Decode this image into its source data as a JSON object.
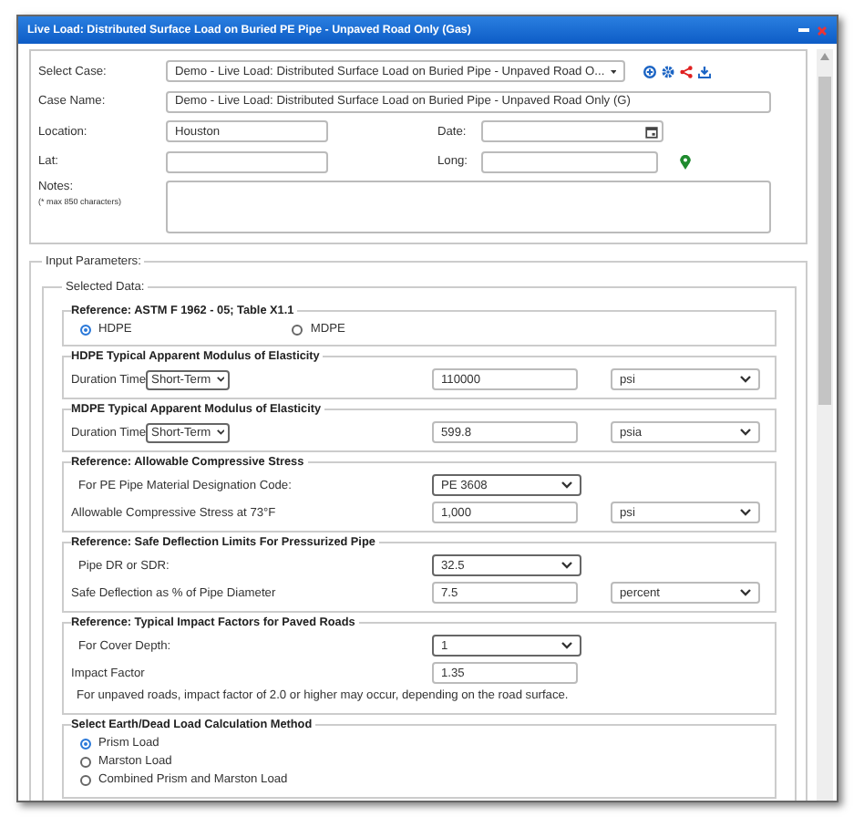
{
  "window": {
    "title": "Live Load: Distributed Surface Load on Buried PE Pipe - Unpaved Road Only (Gas)"
  },
  "case": {
    "select_case": {
      "label": "Select Case:",
      "value": "Demo - Live Load: Distributed Surface Load on Buried Pipe - Unpaved Road O..."
    },
    "case_name": {
      "label": "Case Name:",
      "value": "Demo - Live Load: Distributed Surface Load on Buried Pipe - Unpaved Road Only (G)"
    },
    "location": {
      "label": "Location:",
      "value": "Houston"
    },
    "date": {
      "label": "Date:"
    },
    "lat": {
      "label": "Lat:"
    },
    "long": {
      "label": "Long:"
    },
    "notes": {
      "label": "Notes:",
      "hint": "(* max 850 characters)"
    }
  },
  "input_parameters": {
    "legend": "Input Parameters:",
    "selected_data": {
      "legend": "Selected Data:",
      "groups": [
        {
          "legend": "Reference: ASTM F 1962 - 05; Table X1.1",
          "rows": [
            {
              "kind": "radios",
              "options": [
                {
                  "label": "HDPE",
                  "selected": true
                },
                {
                  "label": "MDPE",
                  "selected": false
                }
              ]
            }
          ]
        },
        {
          "legend": "HDPE Typical Apparent Modulus of Elasticity",
          "rows": [
            {
              "kind": "field",
              "label": "Duration Time",
              "inline_select": "Short-Term",
              "value": "110000",
              "unit": "psi"
            }
          ]
        },
        {
          "legend": "MDPE Typical Apparent Modulus of Elasticity",
          "rows": [
            {
              "kind": "field",
              "label": "Duration Time",
              "inline_select": "Short-Term",
              "value": "599.8",
              "unit": "psia"
            }
          ]
        },
        {
          "legend": "Reference: Allowable Compressive Stress",
          "rows": [
            {
              "kind": "select",
              "label": "For PE Pipe Material Designation Code:",
              "value": "PE 3608"
            },
            {
              "kind": "field",
              "label": "Allowable Compressive Stress at 73°F",
              "value": "1,000",
              "unit": "psi"
            }
          ]
        },
        {
          "legend": "Reference: Safe Deflection Limits For Pressurized Pipe",
          "rows": [
            {
              "kind": "select",
              "label": "Pipe DR or SDR:",
              "value": "32.5"
            },
            {
              "kind": "field",
              "label": "Safe Deflection as % of Pipe Diameter",
              "value": "7.5",
              "unit": "percent"
            }
          ]
        },
        {
          "legend": "Reference: Typical Impact Factors for Paved Roads",
          "rows": [
            {
              "kind": "select",
              "label": "For Cover Depth:",
              "value": "1"
            },
            {
              "kind": "field",
              "label": "Impact Factor",
              "value": "1.35"
            },
            {
              "kind": "note",
              "text": "For unpaved roads, impact factor of 2.0 or higher may occur, depending on the road surface."
            }
          ]
        },
        {
          "legend": "Select Earth/Dead Load Calculation Method",
          "rows": [
            {
              "kind": "radio_list",
              "options": [
                {
                  "label": "Prism Load",
                  "selected": true
                },
                {
                  "label": "Marston Load",
                  "selected": false
                },
                {
                  "label": "Combined Prism and Marston Load",
                  "selected": false
                }
              ]
            }
          ]
        }
      ]
    }
  }
}
